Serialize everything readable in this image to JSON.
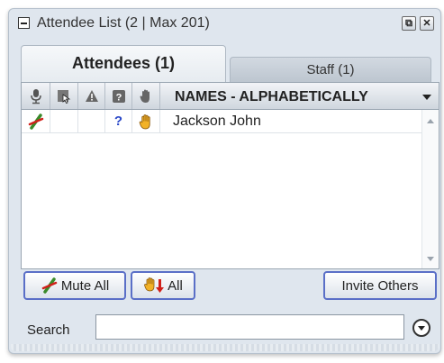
{
  "window": {
    "title": "Attendee List  (2 | Max 201)",
    "restore_glyph": "⧉",
    "close_glyph": "✕"
  },
  "tabs": [
    {
      "label": "Attendees (1)",
      "active": true
    },
    {
      "label": "Staff (1)",
      "active": false
    }
  ],
  "list": {
    "header": {
      "columns": [
        "mic-icon",
        "screen-share-icon",
        "warning-icon",
        "question-icon",
        "raise-hand-icon"
      ],
      "names_label": "NAMES - ALPHABETICALLY"
    },
    "rows": [
      {
        "name": "Jackson John",
        "muted": true,
        "question": "?",
        "hand_raised": true
      }
    ]
  },
  "buttons": {
    "mute_all": "Mute All",
    "hands_all": "All",
    "invite_others": "Invite Others"
  },
  "search": {
    "label": "Search",
    "value": "",
    "placeholder": ""
  },
  "colors": {
    "panel": "#dfe6ee",
    "button_border": "#5a6fc7",
    "mute_green": "#3a8a2a",
    "mute_red": "#d0201a",
    "hand_yellow": "#f2b227",
    "question_blue": "#2a48c8"
  }
}
